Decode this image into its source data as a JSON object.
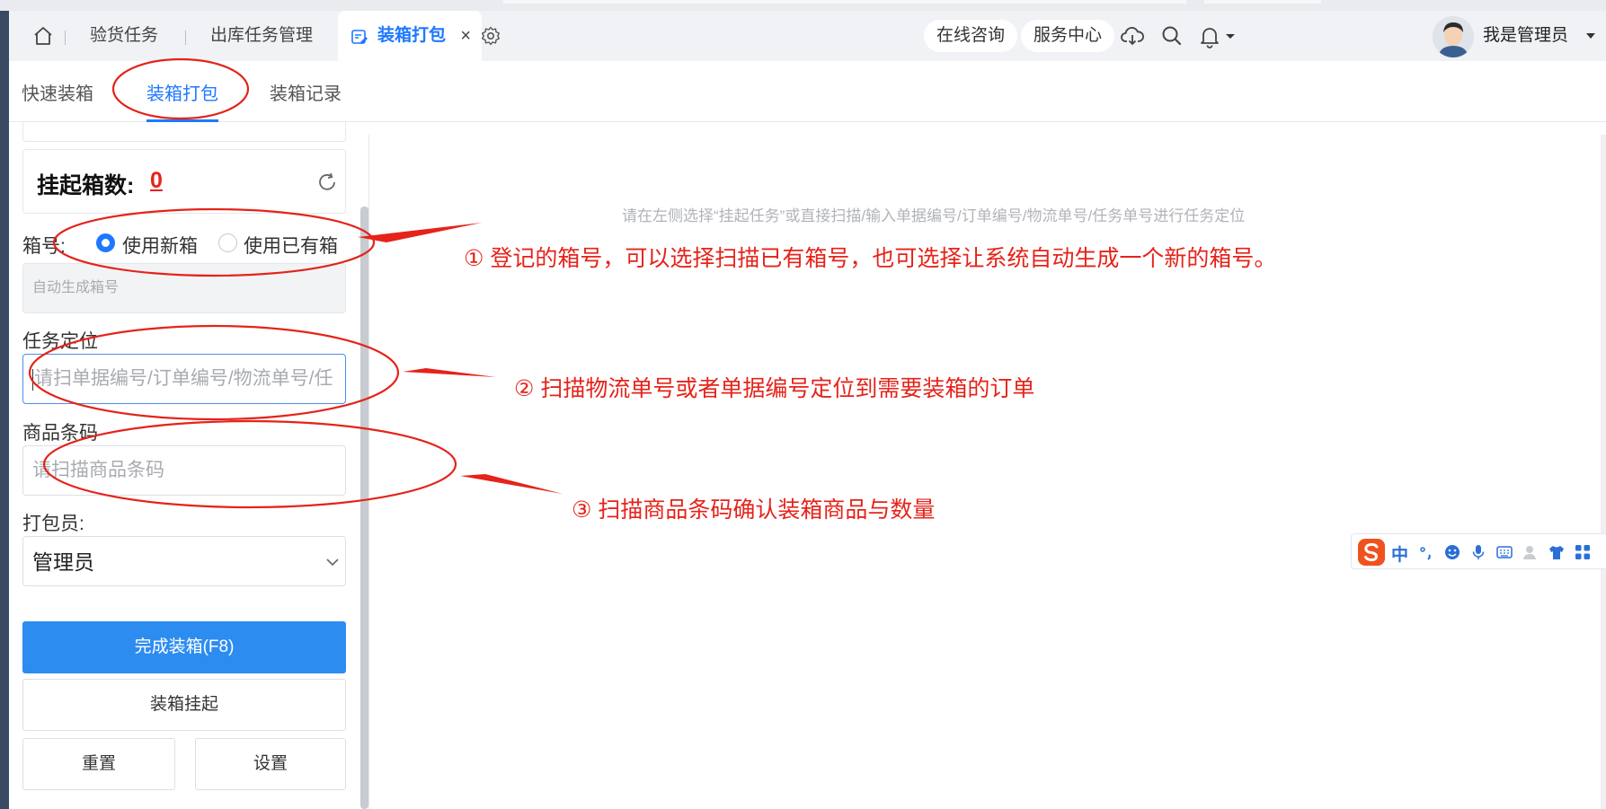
{
  "header": {
    "tabs": [
      {
        "label": "验货任务"
      },
      {
        "label": "出库任务管理"
      },
      {
        "label": "装箱打包"
      }
    ],
    "close_glyph": "×",
    "pills": [
      "在线咨询",
      "服务中心"
    ],
    "icons": [
      "home-icon",
      "gear-icon",
      "cloud-download-icon",
      "search-icon",
      "bell-icon",
      "caret-down-icon"
    ],
    "user_name": "我是管理员"
  },
  "subtabs": [
    "快速装箱",
    "装箱打包",
    "装箱记录"
  ],
  "panel": {
    "suspend_label": "挂起箱数:",
    "suspend_count": "0",
    "box_no_label": "箱号:",
    "radio_new": "使用新箱",
    "radio_existing": "使用已有箱",
    "box_no_placeholder": "自动生成箱号",
    "task_label": "任务定位",
    "task_placeholder": "请扫单据编号/订单编号/物流单号/任",
    "barcode_label": "商品条码",
    "barcode_placeholder": "请扫描商品条码",
    "packer_label": "打包员:",
    "packer_value": "管理员",
    "btn_finish": "完成装箱(F8)",
    "btn_suspend": "装箱挂起",
    "btn_reset": "重置",
    "btn_settings": "设置"
  },
  "main": {
    "hint": "请在左侧选择“挂起任务”或直接扫描/输入单据编号/订单编号/物流单号/任务单号进行任务定位"
  },
  "annotations": [
    "① 登记的箱号，可以选择扫描已有箱号，也可选择让系统自动生成一个新的箱号。",
    "② 扫描物流单号或者单据编号定位到需要装箱的订单",
    "③ 扫描商品条码确认装箱商品与数量"
  ],
  "ime": {
    "label": "中"
  },
  "colors": {
    "accent": "#1e78ff",
    "annotation": "#e5231a",
    "primary_button": "#2d8cf0"
  }
}
